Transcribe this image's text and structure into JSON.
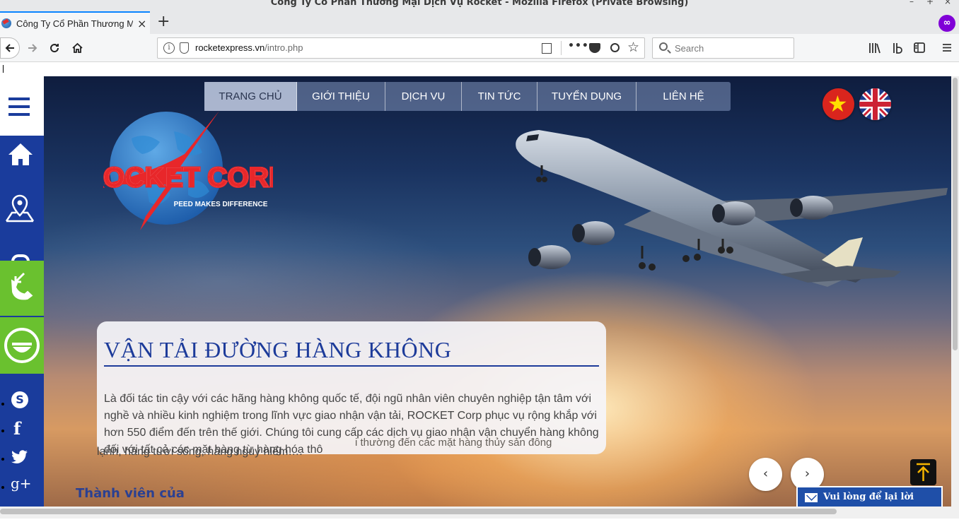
{
  "browser": {
    "window_title": "Công Ty Cổ Phần Thương Mại Dịch Vụ Rocket - Mozilla Firefox (Private Browsing)",
    "window_controls": [
      "–",
      "+",
      "×"
    ],
    "tab_title": "Công Ty Cổ Phần Thương Mại Dịch Vụ Rocket",
    "tab_close": "×",
    "new_tab": "+",
    "url_domain": "rocketexpress.vn",
    "url_path": "/intro.php",
    "search_placeholder": "Search",
    "page_actions": "•••",
    "toolbar_icons": [
      "library-icon",
      "container-icon",
      "sidebar-icon",
      "menu-icon"
    ]
  },
  "nav": {
    "items": [
      "TRANG CHỦ",
      "GIỚI THIỆU",
      "DỊCH VỤ",
      "TIN TỨC",
      "TUYỂN DỤNG",
      "LIÊN HỆ"
    ],
    "active": "TRANG CHỦ"
  },
  "languages": [
    "Vietnamese",
    "English"
  ],
  "logo": {
    "name": "ROCKET CORP",
    "tagline": "PEED MAKES DIFFERENCE"
  },
  "slide": {
    "title": "VẬN TẢI ĐƯỜNG HÀNG KHÔNG",
    "body": "Là đối tác tin cậy với các hãng hàng không quốc tế, đội ngũ nhân viên chuyên nghiệp tận tâm với nghề và nhiều kinh nghiệm trong lĩnh vực giao nhận vận tải, ROCKET Corp phục vụ rộng khắp với hơn 550 điểm đến trên thế giới. Chúng tôi cung cấp các dịch vụ giao nhận vận chuyển hàng không đối với tất cả các mặt hàng từ hàng hóa thô",
    "body_tail": "lạnh, hàng tươi sống, hàng nguy hiểm….",
    "ghost_text": "i thường đến các mặt hàng thủy sản đông",
    "prev": "‹",
    "next": "›"
  },
  "member_text": "Thành viên của",
  "message_widget": "Vui lòng để lại lời nhắn",
  "sidebar": {
    "icons": [
      "menu-icon",
      "home-icon",
      "map-pin-icon",
      "phone-icon",
      "chat-icon",
      "skype-icon",
      "facebook-icon",
      "twitter-icon",
      "google-plus-icon"
    ],
    "social_glyphs": {
      "skype": "S",
      "facebook": "f",
      "twitter": "t",
      "google": "g+"
    }
  },
  "colors": {
    "sidebar_blue": "#1a3c9c",
    "contact_green": "#6ac12f",
    "title_blue": "#1d3b9a",
    "logo_red": "#e8272a"
  }
}
